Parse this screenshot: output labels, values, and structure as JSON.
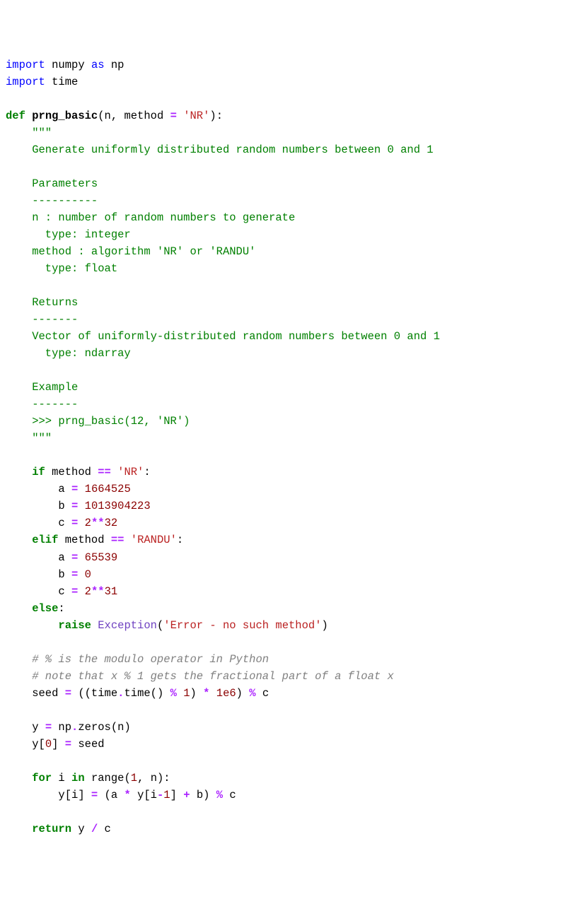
{
  "lines": {
    "l1_import": "import",
    "l1_numpy": " numpy ",
    "l1_as": "as",
    "l1_np": " np",
    "l2_import": "import",
    "l2_time": " time",
    "blank": "",
    "l4_def": "def",
    "l4_sp": " ",
    "l4_fn": "prng_basic",
    "l4_open": "(n, method ",
    "l4_eq": "=",
    "l4_sp2": " ",
    "l4_str": "'NR'",
    "l4_close": "):",
    "l5": "    \"\"\"",
    "l6": "    Generate uniformly distributed random numbers between 0 and 1",
    "l8": "    Parameters",
    "l9": "    ----------",
    "l10": "    n : number of random numbers to generate",
    "l11": "      type: integer",
    "l12": "    method : algorithm 'NR' or 'RANDU'",
    "l13": "      type: float",
    "l15": "    Returns",
    "l16": "    -------",
    "l17": "    Vector of uniformly-distributed random numbers between 0 and 1",
    "l18": "      type: ndarray",
    "l20": "    Example",
    "l21": "    -------",
    "l22": "    >>> prng_basic(12, 'NR')",
    "l23": "    \"\"\"",
    "l25_if": "    if",
    "l25_rest1": " method ",
    "l25_op": "==",
    "l25_sp": " ",
    "l25_str": "'NR'",
    "l25_colon": ":",
    "l26_pre": "        a ",
    "l26_eq": "=",
    "l26_sp": " ",
    "l26_num": "1664525",
    "l27_pre": "        b ",
    "l27_eq": "=",
    "l27_sp": " ",
    "l27_num": "1013904223",
    "l28_pre": "        c ",
    "l28_eq": "=",
    "l28_sp": " ",
    "l28_n1": "2",
    "l28_op": "**",
    "l28_n2": "32",
    "l29_elif": "    elif",
    "l29_rest1": " method ",
    "l29_op": "==",
    "l29_sp": " ",
    "l29_str": "'RANDU'",
    "l29_colon": ":",
    "l30_pre": "        a ",
    "l30_eq": "=",
    "l30_sp": " ",
    "l30_num": "65539",
    "l31_pre": "        b ",
    "l31_eq": "=",
    "l31_sp": " ",
    "l31_num": "0",
    "l32_pre": "        c ",
    "l32_eq": "=",
    "l32_sp": " ",
    "l32_n1": "2",
    "l32_op": "**",
    "l32_n2": "31",
    "l33_else": "    else",
    "l33_colon": ":",
    "l34_sp": "        ",
    "l34_raise": "raise",
    "l34_sp2": " ",
    "l34_exc": "Exception",
    "l34_open": "(",
    "l34_str": "'Error - no such method'",
    "l34_close": ")",
    "l36": "    # % is the modulo operator in Python",
    "l37": "    # note that x % 1 gets the fractional part of a float x",
    "l38_pre": "    seed ",
    "l38_eq": "=",
    "l38_t1": " ((time",
    "l38_dot": ".",
    "l38_t2": "time() ",
    "l38_mod1": "%",
    "l38_sp1": " ",
    "l38_n1": "1",
    "l38_t3": ") ",
    "l38_mul": "*",
    "l38_sp2": " ",
    "l38_n2": "1e6",
    "l38_t4": ") ",
    "l38_mod2": "%",
    "l38_t5": " c",
    "l40_pre": "    y ",
    "l40_eq": "=",
    "l40_rest": " np",
    "l40_dot": ".",
    "l40_z": "zeros(n)",
    "l41_pre": "    y[",
    "l41_n": "0",
    "l41_rest1": "] ",
    "l41_eq": "=",
    "l41_rest2": " seed",
    "l43_sp": "    ",
    "l43_for": "for",
    "l43_i": " i ",
    "l43_in": "in",
    "l43_sp2": " ",
    "l43_range": "range",
    "l43_open": "(",
    "l43_n1": "1",
    "l43_c": ", n):",
    "l44_pre": "        y[i] ",
    "l44_eq": "=",
    "l44_t1": " (a ",
    "l44_mul": "*",
    "l44_t2": " y[i",
    "l44_minus": "-",
    "l44_n1": "1",
    "l44_t3": "] ",
    "l44_plus": "+",
    "l44_t4": " b) ",
    "l44_mod": "%",
    "l44_t5": " c",
    "l46_sp": "    ",
    "l46_return": "return",
    "l46_t1": " y ",
    "l46_div": "/",
    "l46_t2": " c"
  }
}
